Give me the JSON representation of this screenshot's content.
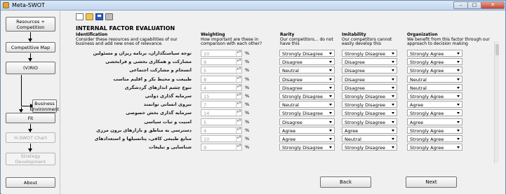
{
  "window": {
    "title": "Meta-SWOT",
    "min_symbol": "–",
    "max_symbol": "□",
    "close_symbol": "✕"
  },
  "sidebar": {
    "buttons": [
      {
        "label": "Resources + Competition",
        "enabled": true
      },
      {
        "label": "Competitive Map",
        "enabled": true
      },
      {
        "label": "(V)RIO",
        "enabled": true
      },
      {
        "label": "Business Environment",
        "enabled": true
      },
      {
        "label": "Fit",
        "enabled": true
      },
      {
        "label": "H-SWOT Chart",
        "enabled": false
      },
      {
        "label": "Strategy Development",
        "enabled": false
      },
      {
        "label": "About",
        "enabled": true
      }
    ]
  },
  "toolbar": {
    "icons": [
      "new-file-icon",
      "open-folder-icon",
      "save-icon",
      "print-icon"
    ]
  },
  "main": {
    "title": "INTERNAL FACTOR EVALUATION",
    "columns": {
      "identification": {
        "title": "Identification",
        "desc": "Consider these resources and capabilities of our business and add new ones of relevance."
      },
      "weighting": {
        "title": "Weighting",
        "desc": "How important are these in comparison with each other?"
      },
      "rarity": {
        "title": "Rarity",
        "desc": "Our competitors... do not have this"
      },
      "imitability": {
        "title": "Imitability",
        "desc": "Our competitors cannot easily develop this"
      },
      "organization": {
        "title": "Organization",
        "desc": "We benefit from this factor through our approach to decision making"
      }
    },
    "percent_symbol": "%",
    "spin_arrows": "▲▼",
    "rows": [
      {
        "factor": "توجه سیاستگذاران، برنامه ریزان و مسئولین",
        "weight": "10",
        "rarity": "Strongly Disagree",
        "imitability": "Strongly Disagree",
        "organization": "Strongly Agree"
      },
      {
        "factor": "مشارکت و همکاری بخشی و فرابخشی",
        "weight": "9",
        "rarity": "Disagree",
        "imitability": "Disagree",
        "organization": "Strongly Agree"
      },
      {
        "factor": "انسجام و مشارکت اجتماعی",
        "weight": "5",
        "rarity": "Neutral",
        "imitability": "Disagree",
        "organization": "Strongly Agree"
      },
      {
        "factor": "طبیعت و محیط بکر و اقلیم مناسب",
        "weight": "8",
        "rarity": "Disagree",
        "imitability": "Disagree",
        "organization": "Neutral"
      },
      {
        "factor": "تنوع چشم اندازهای گردشگری",
        "weight": "4",
        "rarity": "Disagree",
        "imitability": "Disagree",
        "organization": "Neutral"
      },
      {
        "factor": "سرمایه گذاری دولتی",
        "weight": "15",
        "rarity": "Strongly Disagree",
        "imitability": "Strongly Disagree",
        "organization": "Strongly Agree"
      },
      {
        "factor": "نیروی انسانی توانمند",
        "weight": "7",
        "rarity": "Neutral",
        "imitability": "Strongly Disagree",
        "organization": "Agree"
      },
      {
        "factor": "سرمایه گذاری بخش خصوصی",
        "weight": "14",
        "rarity": "Strongly Disagree",
        "imitability": "Strongly Disagree",
        "organization": "Strongly Agree"
      },
      {
        "factor": "امنیت و ثبات سیاسی",
        "weight": "5",
        "rarity": "Disagree",
        "imitability": "Strongly Disagree",
        "organization": "Agree"
      },
      {
        "factor": "دسترسی به مناطق و بازارهای برون مرزی",
        "weight": "4",
        "rarity": "Agree",
        "imitability": "Agree",
        "organization": "Strongly Agree"
      },
      {
        "factor": "منابع طبیعی کافی، پتانسیلها و استعدادهای",
        "weight": "10",
        "rarity": "Agree",
        "imitability": "Neutral",
        "organization": "Strongly Agree"
      },
      {
        "factor": "شناسایی و تبلیغات",
        "weight": "9",
        "rarity": "Strongly Disagree",
        "imitability": "Strongly Disagree",
        "organization": "Strongly Agree"
      }
    ]
  },
  "footer": {
    "back_label": "Back",
    "next_label": "Next"
  }
}
